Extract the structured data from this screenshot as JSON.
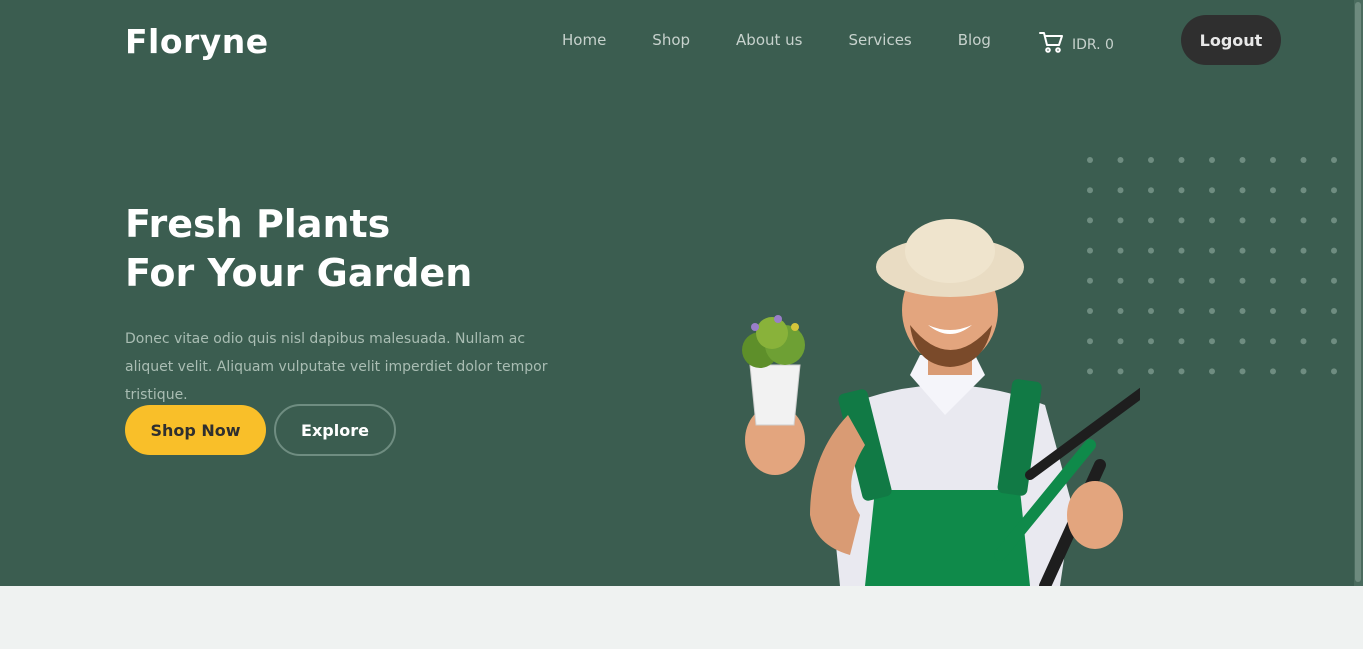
{
  "brand": {
    "logo": "Floryne"
  },
  "nav": {
    "items": [
      {
        "label": "Home"
      },
      {
        "label": "Shop"
      },
      {
        "label": "About us"
      },
      {
        "label": "Services"
      },
      {
        "label": "Blog"
      }
    ]
  },
  "cart": {
    "icon": "cart-icon",
    "amount": "IDR. 0"
  },
  "auth": {
    "logout_label": "Logout"
  },
  "hero": {
    "headline_line1": "Fresh Plants",
    "headline_line2": "For Your Garden",
    "description": "Donec vitae odio quis nisl dapibus malesuada. Nullam ac aliquet velit. Aliquam vulputate velit imperdiet dolor tempor tristique.",
    "primary_button": "Shop Now",
    "secondary_button": "Explore",
    "image": "gardener-holding-plant-and-shears"
  },
  "colors": {
    "hero_background": "#3b5d50",
    "accent_yellow": "#f9bf29",
    "dark_button": "#2f2f2f",
    "page_background": "#eff2f1"
  }
}
